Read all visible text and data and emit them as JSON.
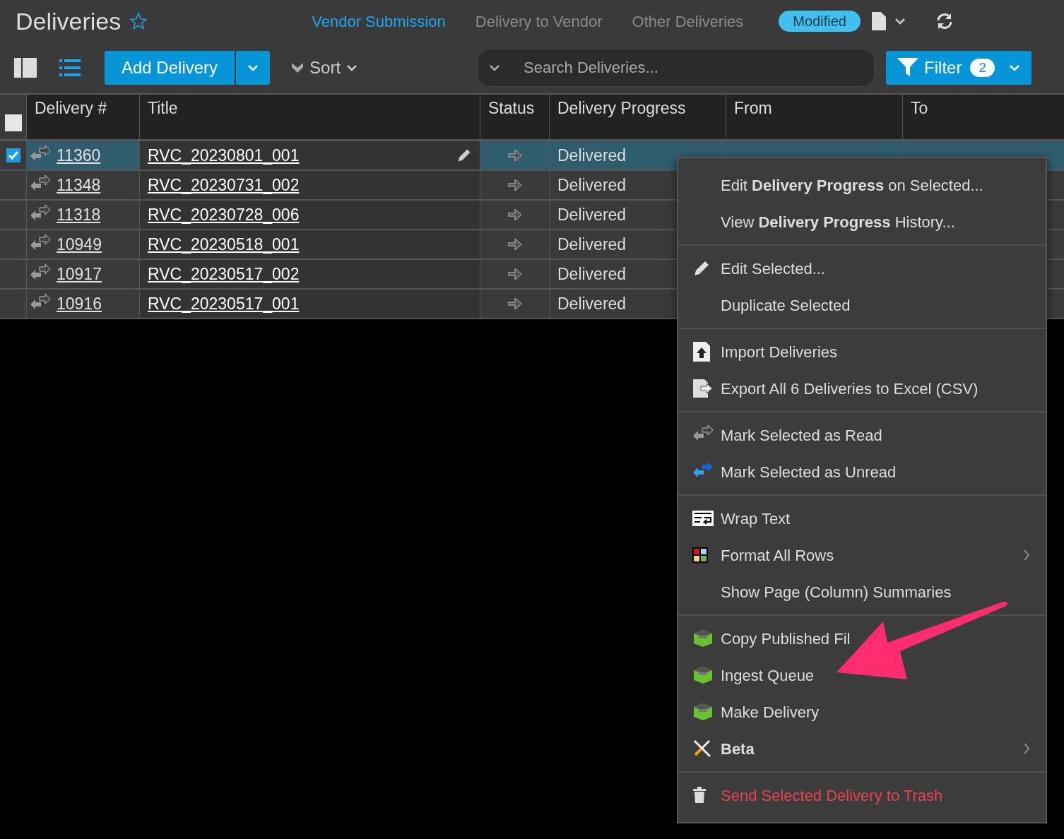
{
  "header": {
    "title": "Deliveries",
    "favorite": false,
    "tabs": [
      {
        "label": "Vendor Submission",
        "selected": true
      },
      {
        "label": "Delivery to Vendor",
        "selected": false
      },
      {
        "label": "Other Deliveries",
        "selected": false
      }
    ],
    "badge": "Modified"
  },
  "toolbar": {
    "add_button": "Add Delivery",
    "sort": "Sort",
    "search": {
      "placeholder": "Search Deliveries..."
    },
    "filter": {
      "label": "Filter",
      "count": "2"
    }
  },
  "table": {
    "select_all_checked": false,
    "columns": [
      "Delivery #",
      "Title",
      "Status",
      "Delivery Progress",
      "From",
      "To"
    ],
    "rows": [
      {
        "number": "11360",
        "title": "RVC_20230801_001",
        "progress": "Delivered",
        "selected": true
      },
      {
        "number": "11348",
        "title": "RVC_20230731_002",
        "progress": "Delivered",
        "selected": false
      },
      {
        "number": "11318",
        "title": "RVC_20230728_006",
        "progress": "Delivered",
        "selected": false
      },
      {
        "number": "10949",
        "title": "RVC_20230518_001",
        "progress": "Delivered",
        "selected": false
      },
      {
        "number": "10917",
        "title": "RVC_20230517_002",
        "progress": "Delivered",
        "selected": false
      },
      {
        "number": "10916",
        "title": "RVC_20230517_001",
        "progress": "Delivered",
        "selected": false
      }
    ]
  },
  "context_menu": {
    "groups": [
      [
        {
          "label": "Edit **Delivery Progress** on Selected...",
          "kind": "normal",
          "submenu": false
        },
        {
          "label": "View **Delivery Progress** History...",
          "kind": "normal",
          "submenu": false
        }
      ],
      [
        {
          "label": "Edit Selected...",
          "kind": "normal",
          "submenu": false
        },
        {
          "label": "Duplicate Selected",
          "kind": "normal",
          "submenu": false
        }
      ],
      [
        {
          "label": "Import Deliveries",
          "kind": "normal",
          "submenu": false
        },
        {
          "label": "Export All 6 Deliveries to Excel (CSV)",
          "kind": "normal",
          "submenu": false
        }
      ],
      [
        {
          "label": "Mark Selected as Read",
          "kind": "normal",
          "submenu": false
        },
        {
          "label": "Mark Selected as Unread",
          "kind": "normal",
          "submenu": false
        }
      ],
      [
        {
          "label": "Wrap Text",
          "kind": "normal",
          "submenu": false
        },
        {
          "label": "Format All Rows",
          "kind": "normal",
          "submenu": true
        },
        {
          "label": "Show Page (Column) Summaries",
          "kind": "normal",
          "submenu": false
        }
      ],
      [
        {
          "label": "Copy Published Fil",
          "kind": "normal",
          "submenu": false
        },
        {
          "label": "Ingest Queue",
          "kind": "normal",
          "submenu": false
        },
        {
          "label": "Make Delivery",
          "kind": "normal",
          "submenu": false
        },
        {
          "label": "Beta",
          "kind": "bold",
          "submenu": true
        }
      ],
      [
        {
          "label": "Send Selected Delivery to Trash",
          "kind": "danger",
          "submenu": false
        }
      ]
    ]
  }
}
